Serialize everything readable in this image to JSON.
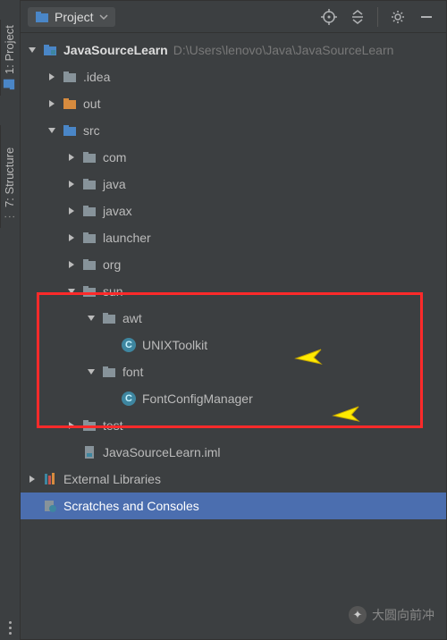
{
  "sidebar": {
    "project_tab": "1: Project",
    "structure_tab": "7: Structure"
  },
  "toolbar": {
    "project_label": "Project"
  },
  "tree": {
    "root": {
      "name": "JavaSourceLearn",
      "path": "D:\\Users\\lenovo\\Java\\JavaSourceLearn"
    },
    "idea": ".idea",
    "out": "out",
    "src": "src",
    "com": "com",
    "java": "java",
    "javax": "javax",
    "launcher": "launcher",
    "org": "org",
    "sun": "sun",
    "awt": "awt",
    "unixtoolkit": "UNIXToolkit",
    "font": "font",
    "fontconfig": "FontConfigManager",
    "test": "test",
    "iml": "JavaSourceLearn.iml",
    "ext_libs": "External Libraries",
    "scratches": "Scratches and Consoles"
  },
  "watermark": "大圆向前冲"
}
